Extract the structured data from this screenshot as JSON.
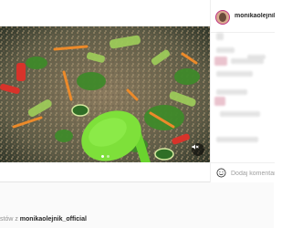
{
  "post": {
    "username": "monikaolejnik_o",
    "media_dot_count": 2,
    "active_dot_index": 0
  },
  "comment": {
    "placeholder": "Dodaj komentarz..."
  },
  "footer": {
    "more_prefix": "stów z ",
    "more_user": "monikaolejnik_official"
  },
  "icons": {
    "mute": "speaker-muted-icon",
    "emoji": "smile-icon"
  },
  "colors": {
    "avatar_ring": "#c13584",
    "username": "#262626",
    "muted_text": "#8e8e8e",
    "spatula": "#7ee03a"
  }
}
